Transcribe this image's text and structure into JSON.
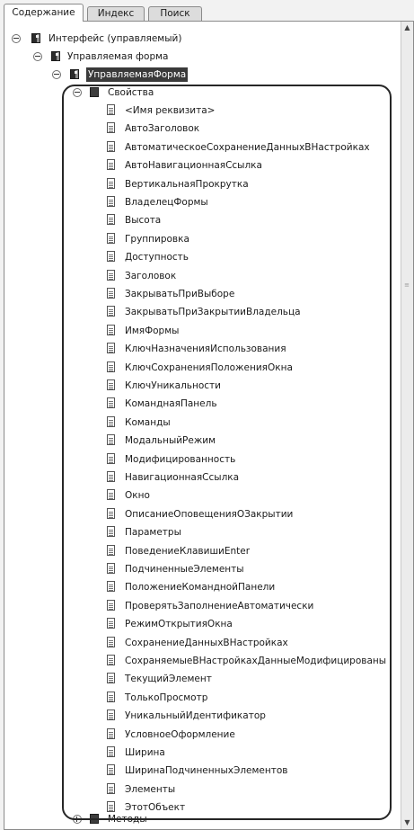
{
  "tabs": [
    {
      "label": "Содержание",
      "active": true
    },
    {
      "label": "Индекс",
      "active": false
    },
    {
      "label": "Поиск",
      "active": false
    }
  ],
  "tree": {
    "root": {
      "label": "Интерфейс (управляемый)",
      "icon": "book-icon",
      "state": "expanded"
    },
    "level1": {
      "label": "Управляемая форма",
      "icon": "book-icon",
      "state": "expanded"
    },
    "level2": {
      "label": "УправляемаяФорма",
      "icon": "book-icon",
      "state": "expanded",
      "selected": true
    },
    "properties": {
      "label": "Свойства",
      "icon": "folder-icon",
      "state": "expanded"
    },
    "property_items": [
      "<Имя реквизита>",
      "АвтоЗаголовок",
      "АвтоматическоеСохранениеДанныхВНастройках",
      "АвтоНавигационнаяСсылка",
      "ВертикальнаяПрокрутка",
      "ВладелецФормы",
      "Высота",
      "Группировка",
      "Доступность",
      "Заголовок",
      "ЗакрыватьПриВыборе",
      "ЗакрыватьПриЗакрытииВладельца",
      "ИмяФормы",
      "КлючНазначенияИспользования",
      "КлючСохраненияПоложенияОкна",
      "КлючУникальности",
      "КоманднаяПанель",
      "Команды",
      "МодальныйРежим",
      "Модифицированность",
      "НавигационнаяСсылка",
      "Окно",
      "ОписаниеОповещенияОЗакрытии",
      "Параметры",
      "ПоведениеКлавишиEnter",
      "ПодчиненныеЭлементы",
      "ПоложениеКоманднойПанели",
      "ПроверятьЗаполнениеАвтоматически",
      "РежимОткрытияОкна",
      "СохранениеДанныхВНастройках",
      "СохраняемыеВНастройкахДанныеМодифицированы",
      "ТекущийЭлемент",
      "ТолькоПросмотр",
      "УникальныйИдентификатор",
      "УсловноеОформление",
      "Ширина",
      "ШиринаПодчиненныхЭлементов",
      "Элементы",
      "ЭтотОбъект"
    ],
    "methods": {
      "label": "Методы",
      "icon": "folder-icon",
      "state": "collapsed"
    }
  },
  "scrollbar": {
    "up_glyph": "▲",
    "down_glyph": "▼",
    "grip_glyph": "≡"
  }
}
